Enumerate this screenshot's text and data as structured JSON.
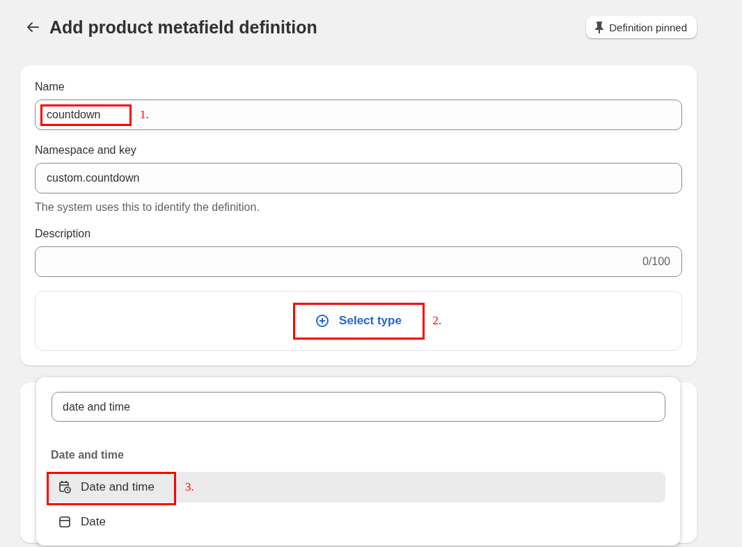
{
  "header": {
    "title": "Add product metafield definition",
    "pin_button": "Definition pinned"
  },
  "fields": [
    {
      "label": "Name",
      "value": "countdown",
      "annotation": "1."
    },
    {
      "label": "Namespace and key",
      "value": "custom.countdown",
      "help": "The system uses this to identify the definition."
    },
    {
      "label": "Description",
      "counter": "0/100"
    }
  ],
  "type_picker": {
    "button": "Select type",
    "annotation": "2."
  },
  "dropdown": {
    "search_value": "date and time",
    "section": "Date and time",
    "options": [
      {
        "label": "Date and time",
        "kind": "datetime",
        "selected": true,
        "annotation": "3."
      },
      {
        "label": "Date",
        "kind": "date",
        "selected": false
      }
    ]
  }
}
